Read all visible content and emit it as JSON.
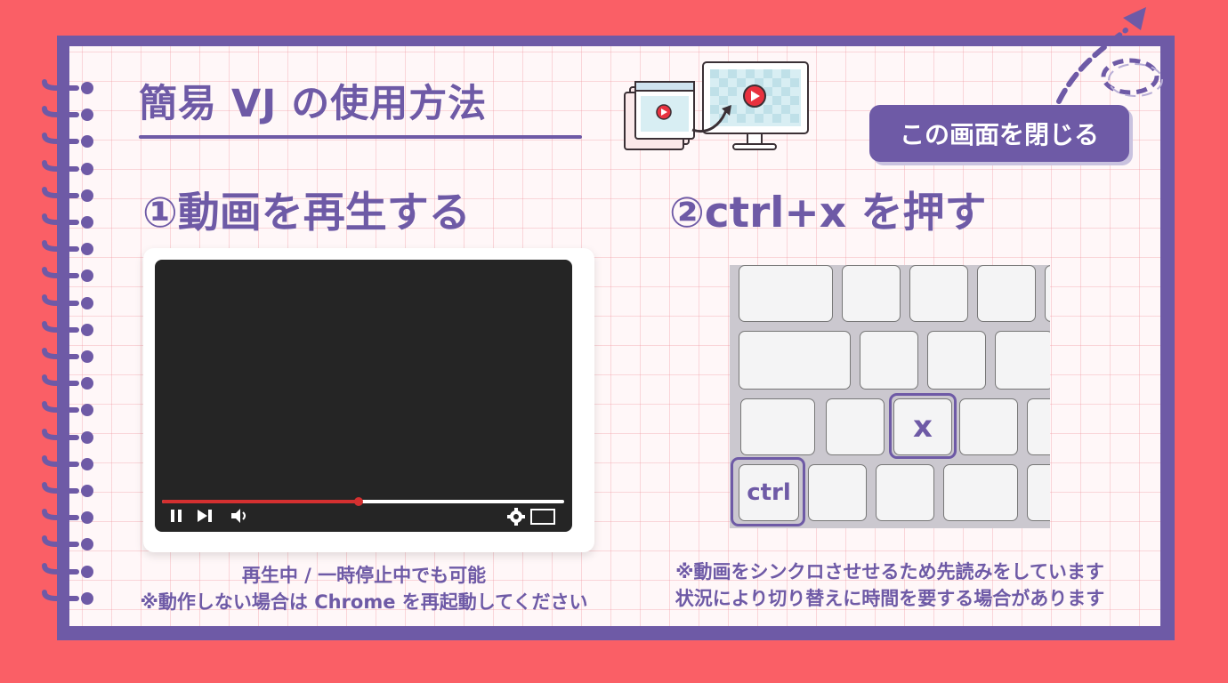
{
  "title": "簡易 VJ の使用方法",
  "close_button": "この画面を閉じる",
  "steps": [
    {
      "label": "①動画を再生する"
    },
    {
      "label": "②ctrl+x を押す"
    }
  ],
  "player": {
    "progress": 0.49,
    "icons": [
      "pause-icon",
      "skip-next-icon",
      "volume-icon",
      "settings-icon",
      "fullscreen-icon"
    ]
  },
  "keyboard": {
    "highlighted_keys": [
      {
        "label": "x"
      },
      {
        "label": "ctrl"
      }
    ]
  },
  "notes": {
    "left": [
      "再生中 / 一時停止中でも可能",
      "※動作しない場合は Chrome を再起動してください"
    ],
    "right": [
      "※動画をシンクロさせせるため先読みをしています",
      "状況により切り替えに時間を要する場合があります"
    ]
  },
  "colors": {
    "background": "#fa5f66",
    "accent": "#6e5aa6",
    "progress": "#d43030"
  }
}
